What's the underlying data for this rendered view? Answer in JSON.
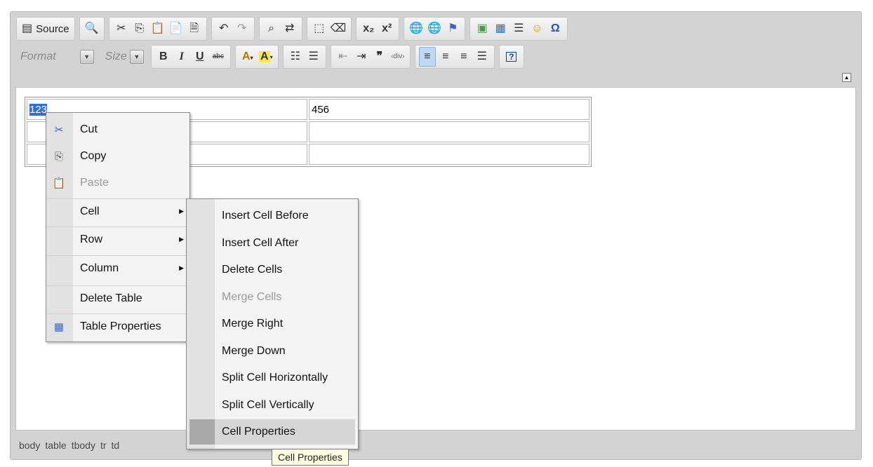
{
  "toolbar": {
    "source_label": "Source",
    "format_placeholder": "Format",
    "size_placeholder": "Size",
    "subscript_label": "x₂",
    "superscript_label": "x²",
    "bold_label": "B",
    "italic_label": "I",
    "underline_label": "U",
    "strike_label": "abc",
    "help_label": "?"
  },
  "table": {
    "rows": [
      [
        "123",
        "456"
      ],
      [
        "",
        ""
      ],
      [
        "",
        ""
      ]
    ]
  },
  "context_menu": {
    "items": [
      {
        "label": "Cut",
        "icon": "cut-icon",
        "enabled": true
      },
      {
        "label": "Copy",
        "icon": "copy-icon",
        "enabled": true
      },
      {
        "label": "Paste",
        "icon": "paste-icon",
        "enabled": false
      },
      {
        "label": "Cell",
        "submenu": true
      },
      {
        "label": "Row",
        "submenu": true
      },
      {
        "label": "Column",
        "submenu": true
      },
      {
        "label": "Delete Table"
      },
      {
        "label": "Table Properties",
        "icon": "table-icon"
      }
    ]
  },
  "cell_submenu": {
    "items": [
      {
        "label": "Insert Cell Before",
        "enabled": true
      },
      {
        "label": "Insert Cell After",
        "enabled": true
      },
      {
        "label": "Delete Cells",
        "enabled": true
      },
      {
        "label": "Merge Cells",
        "enabled": false
      },
      {
        "label": "Merge Right",
        "enabled": true
      },
      {
        "label": "Merge Down",
        "enabled": true
      },
      {
        "label": "Split Cell Horizontally",
        "enabled": true
      },
      {
        "label": "Split Cell Vertically",
        "enabled": true
      },
      {
        "label": "Cell Properties",
        "enabled": true,
        "hovered": true
      }
    ]
  },
  "tooltip": "Cell Properties",
  "element_path": [
    "body",
    "table",
    "tbody",
    "tr",
    "td"
  ],
  "colors": {
    "selection": "#2f6fd7",
    "chrome": "#d3d3d3",
    "active_button": "#bfd9f5"
  }
}
